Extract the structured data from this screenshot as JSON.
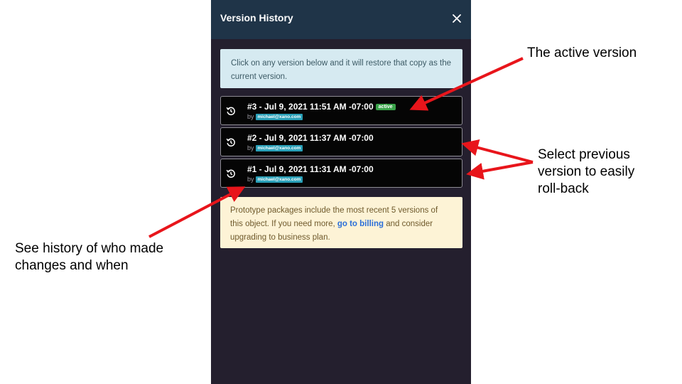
{
  "panel": {
    "title": "Version History",
    "close_icon": "close-icon",
    "info_text": "Click on any version below and it will restore that copy as the current version.",
    "versions": [
      {
        "title": "#3 - Jul 9, 2021 11:51 AM -07:00",
        "by": "by",
        "email": "michael@xano.com",
        "badge": "active"
      },
      {
        "title": "#2 - Jul 9, 2021 11:37 AM -07:00",
        "by": "by",
        "email": "michael@xano.com"
      },
      {
        "title": "#1 - Jul 9, 2021 11:31 AM -07:00",
        "by": "by",
        "email": "michael@xano.com"
      }
    ],
    "warning": {
      "text_before": "Prototype packages include the most recent 5 versions of this object. If you need more, ",
      "link": "go to billing",
      "text_after": " and consider upgrading to business plan."
    }
  },
  "annotations": {
    "active_version": "The active version",
    "select_previous_line1": "Select previous",
    "select_previous_line2": "version to easily",
    "select_previous_line3": "roll-back",
    "history_line1": "See history of who made",
    "history_line2": "changes and when"
  },
  "colors": {
    "panel_bg": "#241f2e",
    "header_bg": "#1f3448",
    "info_bg": "#d6eaf1",
    "warning_bg": "#fdf3d6",
    "active_badge": "#3aa34a",
    "email_badge": "#2aa0b8",
    "link": "#2b6fd9",
    "arrow": "#e8151b"
  }
}
